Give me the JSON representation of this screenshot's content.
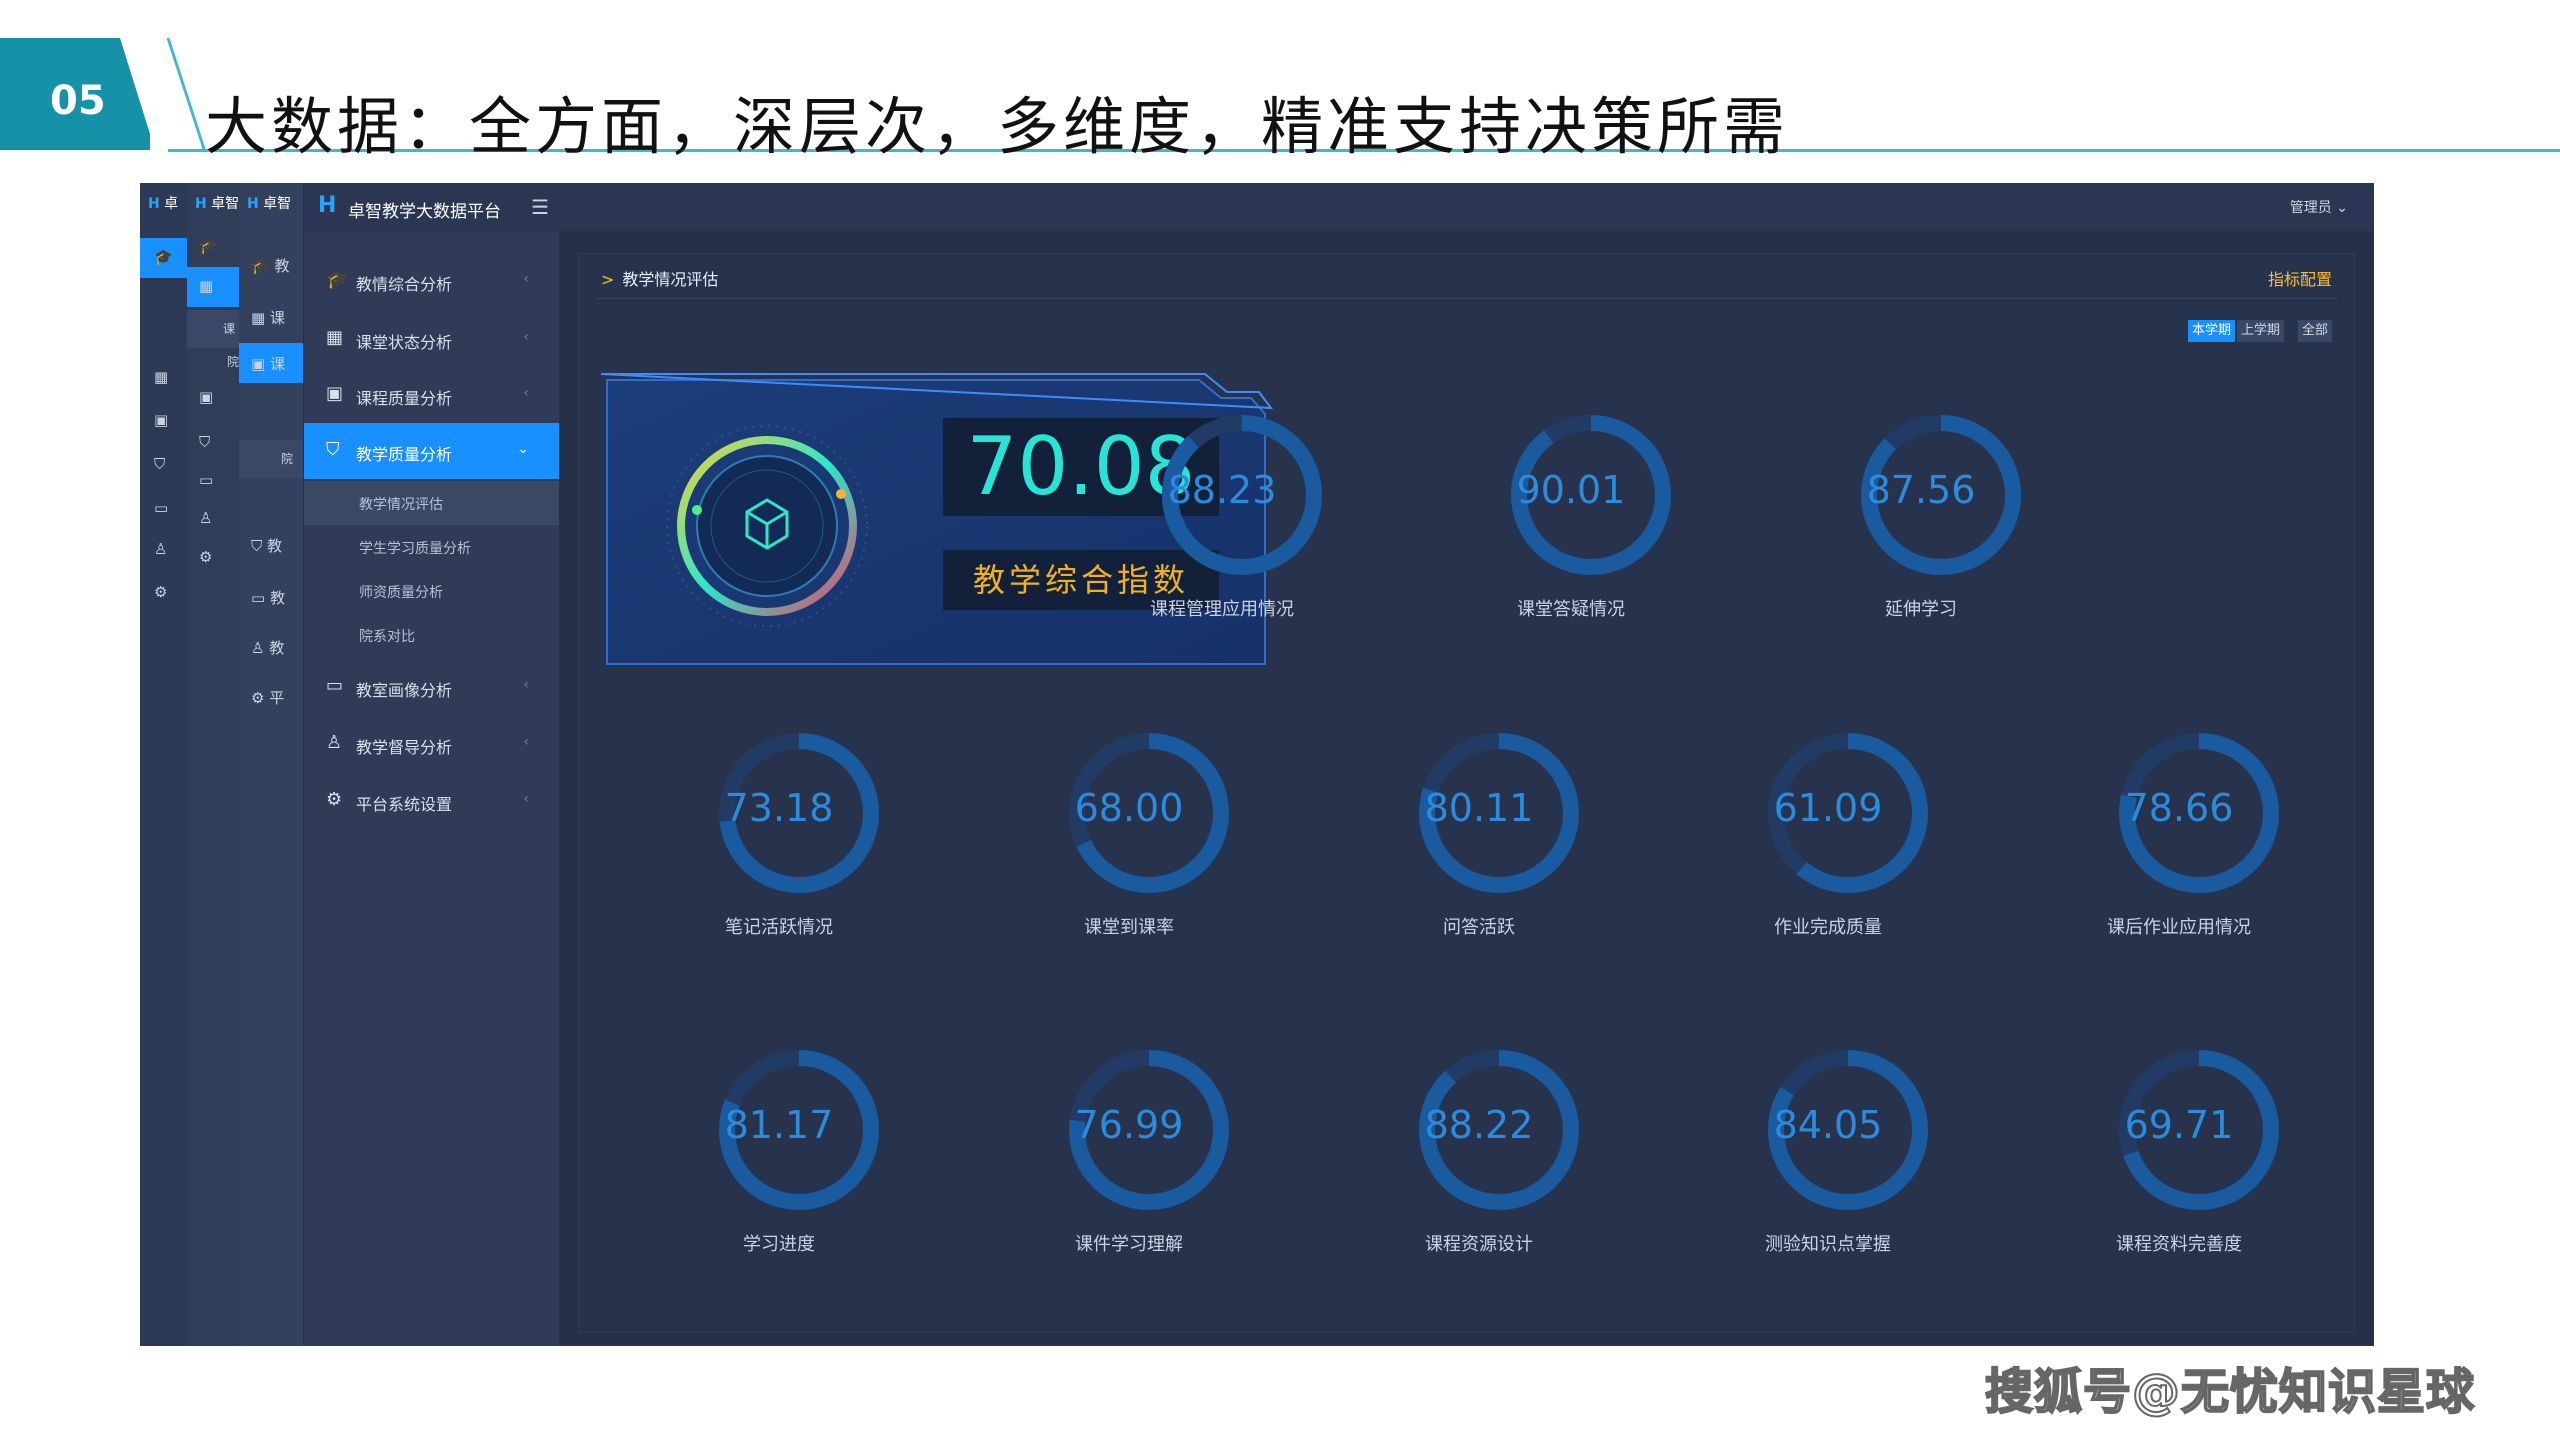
{
  "slide": {
    "number": "05",
    "title": "大数据：全方面，深层次，多维度，精准支持决策所需"
  },
  "app": {
    "brand": "卓智教学大数据平台",
    "admin_menu": "管理员 ⌄",
    "ghost_logo_1": "卓",
    "ghost_logo_2": "卓智",
    "ghost_logo_3": "卓智",
    "ghost_sub_1": "课",
    "ghost_sub_2": "院",
    "ghost_items": [
      "教",
      "课",
      "课",
      "院",
      "教",
      "教",
      "教",
      "平"
    ],
    "menu": [
      {
        "label": "教情综合分析",
        "icon": "graduation-cap-icon",
        "glyph": "🎓"
      },
      {
        "label": "课堂状态分析",
        "icon": "chart-icon",
        "glyph": "▦"
      },
      {
        "label": "课程质量分析",
        "icon": "save-icon",
        "glyph": "▣"
      },
      {
        "label": "教学质量分析",
        "icon": "shield-icon",
        "glyph": "⛉"
      },
      {
        "label": "教室画像分析",
        "icon": "monitor-icon",
        "glyph": "▭"
      },
      {
        "label": "教学督导分析",
        "icon": "user-icon",
        "glyph": "♙"
      },
      {
        "label": "平台系统设置",
        "icon": "gear-icon",
        "glyph": "⚙"
      }
    ],
    "submenu": [
      "教学情况评估",
      "学生学习质量分析",
      "师资质量分析",
      "院系对比"
    ],
    "panel": {
      "title": "教学情况评估",
      "config": "指标配置",
      "tabs": [
        "本学期",
        "上学期",
        "全部"
      ]
    },
    "hero": {
      "value": "70.08",
      "label": "教学综合指数"
    },
    "metrics": [
      {
        "value": "88.23",
        "label": "课程管理应用情况",
        "percent": 88.23
      },
      {
        "value": "90.01",
        "label": "课堂答疑情况",
        "percent": 90.01
      },
      {
        "value": "87.56",
        "label": "延伸学习",
        "percent": 87.56
      },
      {
        "value": "73.18",
        "label": "笔记活跃情况",
        "percent": 73.18
      },
      {
        "value": "68.00",
        "label": "课堂到课率",
        "percent": 68.0
      },
      {
        "value": "80.11",
        "label": "问答活跃",
        "percent": 80.11
      },
      {
        "value": "61.09",
        "label": "作业完成质量",
        "percent": 61.09
      },
      {
        "value": "78.66",
        "label": "课后作业应用情况",
        "percent": 78.66
      },
      {
        "value": "81.17",
        "label": "学习进度",
        "percent": 81.17
      },
      {
        "value": "76.99",
        "label": "课件学习理解",
        "percent": 76.99
      },
      {
        "value": "88.22",
        "label": "课程资源设计",
        "percent": 88.22
      },
      {
        "value": "84.05",
        "label": "测验知识点掌握",
        "percent": 84.05
      },
      {
        "value": "69.71",
        "label": "课程资料完善度",
        "percent": 69.71
      }
    ]
  },
  "watermark": "搜狐号@无忧知识星球",
  "colors": {
    "accent": "#1890ff",
    "ring": "#1a5a9e",
    "ring_track": "#223b64",
    "hero_value": "#29e3d7",
    "hero_label": "#f2b21c",
    "config": "#ffbd2e"
  }
}
